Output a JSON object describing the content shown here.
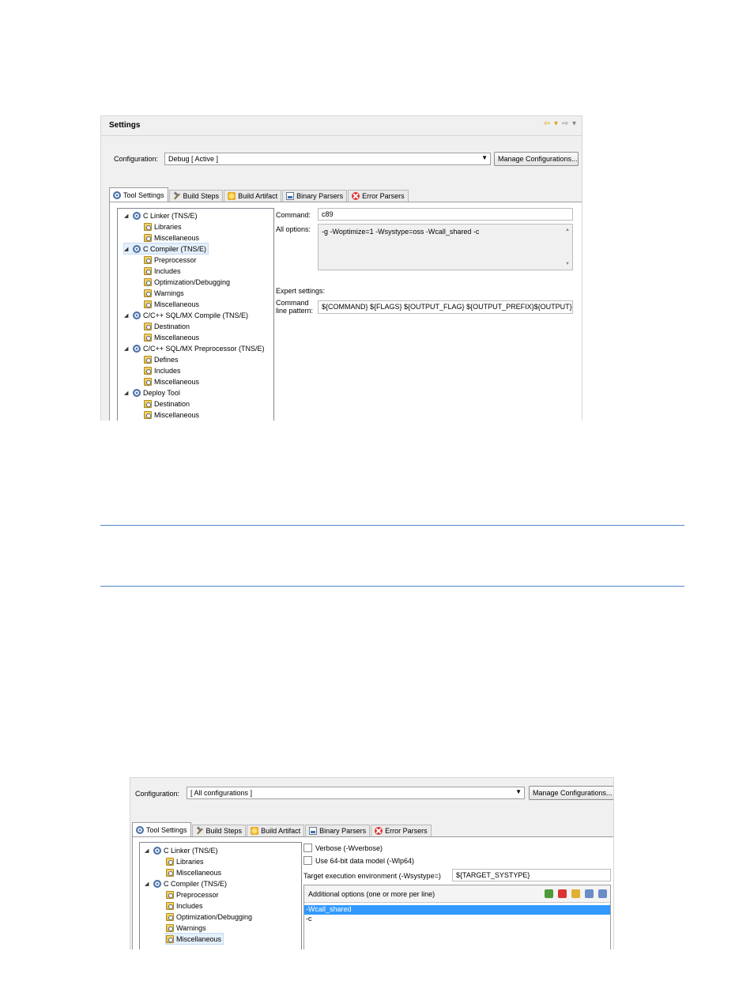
{
  "shot1": {
    "title": "Settings",
    "nav_back": "⇦ ▾",
    "nav_forward": "⇨ ▾",
    "configuration_label": "Configuration:",
    "configuration_value": "Debug  [ Active ]",
    "manage_button": "Manage Configurations...",
    "tabs": [
      {
        "label": "Tool Settings",
        "icon": "gear-icon",
        "active": true
      },
      {
        "label": "Build Steps",
        "icon": "hammer-icon"
      },
      {
        "label": "Build Artifact",
        "icon": "artifact-icon"
      },
      {
        "label": "Binary Parsers",
        "icon": "binary-icon"
      },
      {
        "label": "Error Parsers",
        "icon": "error-icon"
      }
    ],
    "tree": [
      {
        "label": "C Linker (TNS/E)",
        "level": 0
      },
      {
        "label": "Libraries",
        "level": 1
      },
      {
        "label": "Miscellaneous",
        "level": 1
      },
      {
        "label": "C Compiler (TNS/E)",
        "level": 0,
        "selected": true
      },
      {
        "label": "Preprocessor",
        "level": 1
      },
      {
        "label": "Includes",
        "level": 1
      },
      {
        "label": "Optimization/Debugging",
        "level": 1
      },
      {
        "label": "Warnings",
        "level": 1
      },
      {
        "label": "Miscellaneous",
        "level": 1
      },
      {
        "label": "C/C++ SQL/MX Compile (TNS/E)",
        "level": 0
      },
      {
        "label": "Destination",
        "level": 1
      },
      {
        "label": "Miscellaneous",
        "level": 1
      },
      {
        "label": "C/C++ SQL/MX Preprocessor (TNS/E)",
        "level": 0
      },
      {
        "label": "Defines",
        "level": 1
      },
      {
        "label": "Includes",
        "level": 1
      },
      {
        "label": "Miscellaneous",
        "level": 1
      },
      {
        "label": "Deploy Tool",
        "level": 0
      },
      {
        "label": "Destination",
        "level": 1
      },
      {
        "label": "Miscellaneous",
        "level": 1
      }
    ],
    "command_label": "Command:",
    "command_value": "c89",
    "all_options_label": "All options:",
    "all_options_value": "-g -Woptimize=1 -Wsystype=oss -Wcall_shared -c",
    "expert_label": "Expert settings:",
    "pattern_label_1": "Command",
    "pattern_label_2": "line pattern:",
    "pattern_value": "${COMMAND} ${FLAGS} ${OUTPUT_FLAG} ${OUTPUT_PREFIX}${OUTPUT} ${INP"
  },
  "shot2": {
    "configuration_label": "Configuration:",
    "configuration_value": "[ All configurations ]",
    "manage_button": "Manage Configurations...",
    "tabs": [
      {
        "label": "Tool Settings",
        "icon": "gear-icon",
        "active": true
      },
      {
        "label": "Build Steps",
        "icon": "hammer-icon"
      },
      {
        "label": "Build Artifact",
        "icon": "artifact-icon"
      },
      {
        "label": "Binary Parsers",
        "icon": "binary-icon"
      },
      {
        "label": "Error Parsers",
        "icon": "error-icon"
      }
    ],
    "tree": [
      {
        "label": "C Linker (TNS/E)",
        "level": 0
      },
      {
        "label": "Libraries",
        "level": 1
      },
      {
        "label": "Miscellaneous",
        "level": 1
      },
      {
        "label": "C Compiler (TNS/E)",
        "level": 0
      },
      {
        "label": "Preprocessor",
        "level": 1
      },
      {
        "label": "Includes",
        "level": 1
      },
      {
        "label": "Optimization/Debugging",
        "level": 1
      },
      {
        "label": "Warnings",
        "level": 1
      },
      {
        "label": "Miscellaneous",
        "level": 1,
        "selected": true
      }
    ],
    "verbose_label": "Verbose (-Wverbose)",
    "wlp64_label": "Use 64-bit data model (-Wlp64)",
    "target_env_label": "Target execution environment (-Wsystype=)",
    "target_env_value": "${TARGET_SYSTYPE}",
    "additional_label": "Additional options (one or more per line)",
    "additional_items": [
      "-Wcall_shared",
      "-c"
    ]
  }
}
